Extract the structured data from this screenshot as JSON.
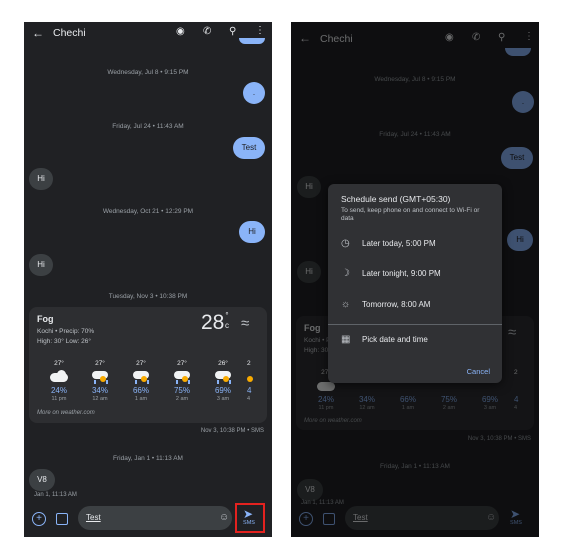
{
  "conversation": {
    "contact_name": "Chechi"
  },
  "messages": {
    "t1": "Wednesday, Jul 8 • 9:15 PM",
    "m1": ".",
    "t2": "Friday, Jul 24 • 11:43 AM",
    "m2": "Test",
    "m3": "Hi",
    "t3": "Wednesday, Oct 21 • 12:29 PM",
    "m4": "Hi",
    "m5": "Hi",
    "t4": "Tuesday, Nov 3 • 10:38 PM",
    "sms_meta": "Nov 3, 10:38 PM • SMS",
    "t5": "Friday, Jan 1 • 11:13 AM",
    "m6": "V8",
    "m6_time": "Jan 1, 11:13 AM"
  },
  "weather": {
    "condition": "Fog",
    "location_line": "Kochi • Precip: 70%",
    "highlow": "High: 30° Low: 26°",
    "temperature": "28",
    "degree": "°",
    "unit": "c",
    "hourly": [
      {
        "temp": "27°",
        "precip": "24%",
        "time": "11 pm",
        "icon": "cloud-moon-icon"
      },
      {
        "temp": "27°",
        "precip": "34%",
        "time": "12 am",
        "icon": "rain-moon-icon"
      },
      {
        "temp": "27°",
        "precip": "66%",
        "time": "1 am",
        "icon": "rain-moon-icon"
      },
      {
        "temp": "27°",
        "precip": "75%",
        "time": "2 am",
        "icon": "rain-moon-icon"
      },
      {
        "temp": "26°",
        "precip": "69%",
        "time": "3 am",
        "icon": "rain-moon-icon"
      },
      {
        "temp": "2",
        "precip": "4",
        "time": "4",
        "icon": "rain-moon-icon"
      }
    ],
    "more_link": "More on weather.com"
  },
  "composer": {
    "text": "Test",
    "send_label": "SMS"
  },
  "schedule_dialog": {
    "title": "Schedule send (GMT+05:30)",
    "subtitle": "To send, keep phone on and connect to Wi-Fi or data",
    "options": [
      {
        "label": "Later today, 5:00 PM",
        "icon": "clock-icon"
      },
      {
        "label": "Later tonight, 9:00 PM",
        "icon": "moon-icon"
      },
      {
        "label": "Tomorrow, 8:00 AM",
        "icon": "sun-icon"
      },
      {
        "label": "Pick date and time",
        "icon": "calendar-icon"
      }
    ],
    "cancel": "Cancel"
  },
  "colors": {
    "background": "#202124",
    "outgoing": "#8ab4f8",
    "incoming": "#3c4043",
    "highlight": "#e3221f"
  }
}
